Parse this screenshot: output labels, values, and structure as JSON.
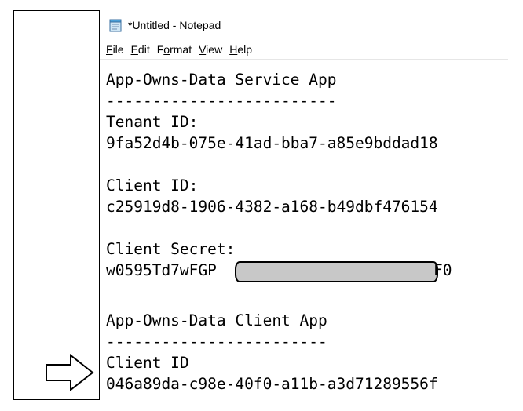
{
  "window": {
    "title": "*Untitled - Notepad",
    "icon": "notepad-icon"
  },
  "menu": [
    {
      "mnemonic": "F",
      "rest": "ile"
    },
    {
      "mnemonic": "E",
      "rest": "dit"
    },
    {
      "pre": "F",
      "mnemonic": "o",
      "rest": "rmat"
    },
    {
      "mnemonic": "V",
      "rest": "iew"
    },
    {
      "mnemonic": "H",
      "rest": "elp"
    }
  ],
  "document": {
    "service_heading": "App-Owns-Data Service App",
    "service_rule": "-------------------------",
    "tenant_label": "Tenant ID:",
    "tenant_value": "9fa52d4b-075e-41ad-bba7-a85e9bddad18",
    "client_label": "Client ID:",
    "client_value": "c25919d8-1906-4382-a168-b49dbf476154",
    "secret_label": "Client Secret:",
    "secret_prefix": "w0595Td7wFGP",
    "secret_suffix": "F0",
    "client_app_heading": "App-Owns-Data Client App",
    "client_app_rule": "------------------------",
    "client_app_id_label": "Client ID",
    "client_app_id_value": "046a89da-c98e-40f0-a11b-a3d71289556f"
  },
  "annotation": {
    "arrow_icon": "right-arrow-icon",
    "redaction": "redaction-box"
  }
}
